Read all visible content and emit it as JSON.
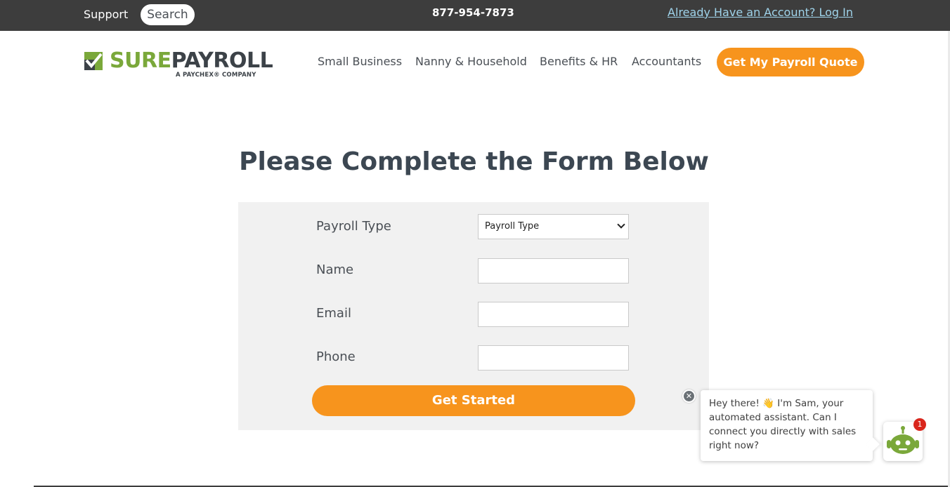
{
  "topbar": {
    "support_label": "Support",
    "search_label": "Search",
    "phone": "877-954-7873",
    "login_label": "Already Have an Account? Log In"
  },
  "header": {
    "logo_sure": "SURE",
    "logo_payroll": "PAYROLL",
    "logo_tagline": "A PAYCHEX® COMPANY",
    "nav": [
      {
        "label": "Small Business"
      },
      {
        "label": "Nanny & Household"
      },
      {
        "label": "Benefits & HR"
      },
      {
        "label": "Accountants"
      }
    ],
    "quote_button": "Get My Payroll Quote"
  },
  "main": {
    "title": "Please Complete the Form Below",
    "form": {
      "payroll_type_label": "Payroll Type",
      "payroll_type_value": "Payroll Type",
      "name_label": "Name",
      "name_value": "",
      "email_label": "Email",
      "email_value": "",
      "phone_label": "Phone",
      "phone_value": "",
      "submit_label": "Get Started"
    }
  },
  "chat": {
    "close_icon": "close-icon",
    "message": "Hey there! 👋 I'm Sam, your automated assistant. Can I connect you directly with sales right now?",
    "badge_count": "1",
    "bot_icon": "robot-icon"
  },
  "colors": {
    "topbar": "#3d3d3d",
    "accent_orange": "#f7941d",
    "brand_green": "#7aa83a",
    "brand_dark": "#3c4248",
    "form_panel": "#f1f1f1",
    "badge_red": "#d9261c"
  }
}
